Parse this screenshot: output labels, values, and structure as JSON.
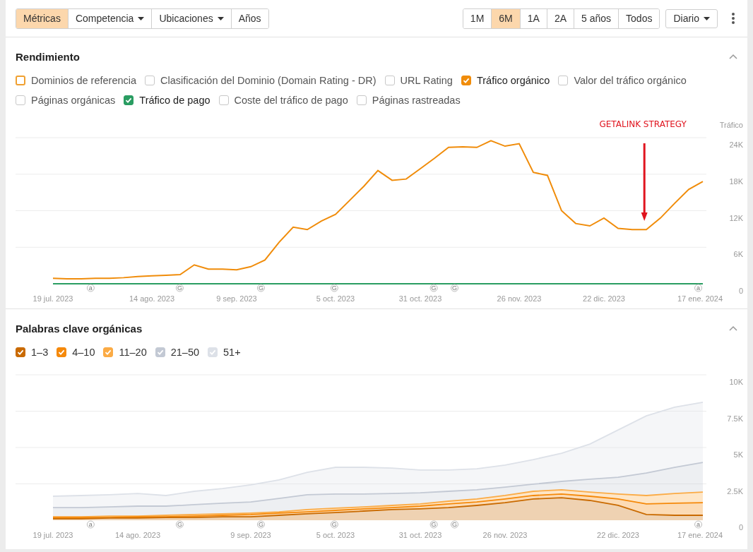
{
  "toolbar": {
    "view_tabs": [
      {
        "label": "Métricas",
        "selected": true,
        "dropdown": false
      },
      {
        "label": "Competencia",
        "selected": false,
        "dropdown": true
      },
      {
        "label": "Ubicaciones",
        "selected": false,
        "dropdown": true
      },
      {
        "label": "Años",
        "selected": false,
        "dropdown": false
      }
    ],
    "range_tabs": [
      {
        "label": "1M",
        "selected": false
      },
      {
        "label": "6M",
        "selected": true
      },
      {
        "label": "1A",
        "selected": false
      },
      {
        "label": "2A",
        "selected": false
      },
      {
        "label": "5 años",
        "selected": false
      },
      {
        "label": "Todos",
        "selected": false
      }
    ],
    "interval": {
      "label": "Diario"
    }
  },
  "performance": {
    "title": "Rendimiento",
    "expanded": true,
    "metrics": [
      {
        "label": "Dominios de referencia",
        "checked": false,
        "color": "#f0a030"
      },
      {
        "label": "Clasificación del Dominio (Domain Rating - DR)",
        "checked": false
      },
      {
        "label": "URL Rating",
        "checked": false
      },
      {
        "label": "Tráfico orgánico",
        "checked": true,
        "color": "#f08c0a"
      },
      {
        "label": "Valor del tráfico orgánico",
        "checked": false
      },
      {
        "label": "Páginas orgánicas",
        "checked": false
      },
      {
        "label": "Tráfico de pago",
        "checked": true,
        "color": "#2a9d62"
      },
      {
        "label": "Coste del tráfico de pago",
        "checked": false
      },
      {
        "label": "Páginas rastreadas",
        "checked": false
      }
    ],
    "chart_data": {
      "type": "line",
      "ylabel": "Tráfico",
      "grid": true,
      "ylim": [
        0,
        24000
      ],
      "yticks": [
        {
          "value": 0,
          "label": "0"
        },
        {
          "value": 6000,
          "label": "6K"
        },
        {
          "value": 12000,
          "label": "12K"
        },
        {
          "value": 18000,
          "label": "18K"
        },
        {
          "value": 24000,
          "label": "24K"
        }
      ],
      "categories": [
        "19 jul. 2023",
        null,
        null,
        null,
        null,
        null,
        null,
        "14 ago. 2023",
        null,
        null,
        null,
        null,
        null,
        "9 sep. 2023",
        null,
        null,
        null,
        null,
        null,
        null,
        "5 oct. 2023",
        null,
        null,
        null,
        null,
        null,
        "31 oct. 2023",
        null,
        null,
        null,
        null,
        null,
        null,
        "26 nov. 2023",
        null,
        null,
        null,
        null,
        null,
        "22 dic. 2023",
        null,
        null,
        null,
        null,
        null,
        null,
        "17 ene. 2024"
      ],
      "series": [
        {
          "color": "#f08c0a",
          "values": [
            900,
            800,
            800,
            900,
            900,
            1000,
            1200,
            1300,
            1400,
            1500,
            3100,
            2400,
            2400,
            2300,
            2800,
            3900,
            6800,
            9300,
            8900,
            10300,
            11400,
            13700,
            16000,
            18600,
            17000,
            17200,
            18900,
            20600,
            22400,
            22500,
            22400,
            23500,
            22600,
            23000,
            18300,
            17800,
            12000,
            9900,
            9500,
            10800,
            9100,
            8900,
            8900,
            10800,
            13200,
            15500,
            16800
          ]
        },
        {
          "color": "#2a9d62",
          "values": [
            0,
            0,
            0,
            0,
            0,
            0,
            0,
            0,
            0,
            0,
            0,
            0,
            0,
            0,
            0,
            0,
            0,
            0,
            0,
            0,
            0,
            0,
            0,
            0,
            0,
            0,
            0,
            0,
            0,
            0,
            0,
            0,
            0,
            0,
            0,
            0,
            0,
            0,
            0,
            0,
            0,
            0,
            0,
            0,
            0,
            0,
            0
          ]
        }
      ],
      "annotations": [
        "GETALINK STRATEGY"
      ]
    },
    "events": [
      {
        "label": "a"
      },
      {
        "label": "G"
      },
      {
        "label": "G"
      },
      {
        "label": "G"
      },
      {
        "label": "G"
      },
      {
        "label": "G"
      },
      {
        "label": "a"
      }
    ]
  },
  "keywords": {
    "title": "Palabras clave orgánicas",
    "expanded": true,
    "positions": [
      {
        "label": "1–3",
        "checked": true,
        "color": "#c96a00"
      },
      {
        "label": "4–10",
        "checked": true,
        "color": "#f5890a"
      },
      {
        "label": "11–20",
        "checked": true,
        "color": "#fbab45"
      },
      {
        "label": "21–50",
        "checked": true,
        "color": "#c3c9d4"
      },
      {
        "label": "51+",
        "checked": true,
        "color": "#dde1e8"
      }
    ],
    "chart_data": {
      "type": "area",
      "stacked": true,
      "grid": true,
      "ylim": [
        0,
        10000
      ],
      "yticks": [
        {
          "value": 0,
          "label": "0"
        },
        {
          "value": 2500,
          "label": "2.5K"
        },
        {
          "value": 5000,
          "label": "5K"
        },
        {
          "value": 7500,
          "label": "7.5K"
        },
        {
          "value": 10000,
          "label": "10K"
        }
      ],
      "categories": [
        "19 jul. 2023",
        null,
        null,
        "14 ago. 2023",
        null,
        null,
        null,
        "9 sep. 2023",
        null,
        null,
        "5 oct. 2023",
        null,
        null,
        "31 oct. 2023",
        null,
        null,
        "26 nov. 2023",
        null,
        null,
        null,
        "22 dic. 2023",
        null,
        null,
        "17 ene. 2024"
      ],
      "series": [
        {
          "color": "#c96a00",
          "values": [
            100,
            100,
            150,
            150,
            190,
            190,
            240,
            240,
            340,
            440,
            530,
            630,
            730,
            780,
            870,
            1020,
            1210,
            1460,
            1550,
            1360,
            1020,
            390,
            340,
            340
          ]
        },
        {
          "color": "#f5890a",
          "values": [
            90,
            90,
            40,
            90,
            50,
            100,
            100,
            150,
            150,
            140,
            150,
            150,
            140,
            190,
            250,
            240,
            250,
            240,
            250,
            290,
            440,
            730,
            830,
            870
          ]
        },
        {
          "color": "#fbab45",
          "values": [
            50,
            50,
            100,
            50,
            100,
            100,
            100,
            100,
            90,
            150,
            150,
            140,
            150,
            150,
            190,
            200,
            240,
            290,
            290,
            290,
            340,
            580,
            670,
            730
          ]
        },
        {
          "color": "#c3c9d4",
          "values": [
            630,
            630,
            630,
            680,
            630,
            680,
            730,
            770,
            920,
            1020,
            970,
            880,
            820,
            770,
            680,
            630,
            580,
            490,
            580,
            880,
            1160,
            1550,
            1800,
            2040
          ]
        },
        {
          "color": "#dde1e8",
          "values": [
            780,
            830,
            830,
            870,
            730,
            920,
            1010,
            1170,
            1270,
            1550,
            1840,
            1840,
            1750,
            1560,
            1460,
            1450,
            1510,
            1690,
            1940,
            2420,
            3250,
            3930,
            4130,
            4130
          ]
        }
      ]
    },
    "events": [
      {
        "label": "a"
      },
      {
        "label": "G"
      },
      {
        "label": "G"
      },
      {
        "label": "G"
      },
      {
        "label": "G"
      },
      {
        "label": "G"
      },
      {
        "label": "a"
      }
    ]
  }
}
